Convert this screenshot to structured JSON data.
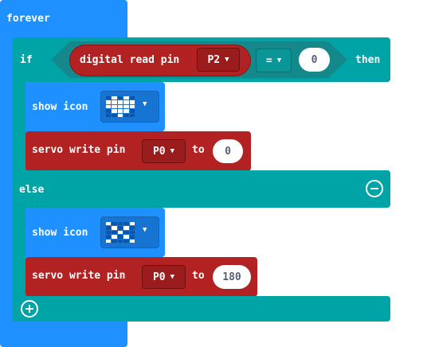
{
  "forever": {
    "label": "forever"
  },
  "if_block": {
    "if_label": "if",
    "then_label": "then",
    "else_label": "else",
    "condition": {
      "read_label": "digital read pin",
      "pin": "P2",
      "operator": "=",
      "value": "0"
    },
    "then_branch": {
      "show_icon_label": "show icon",
      "icon": "heart-icon",
      "icon_pattern": [
        0,
        1,
        0,
        1,
        0,
        1,
        1,
        1,
        1,
        1,
        1,
        1,
        1,
        1,
        1,
        0,
        1,
        1,
        1,
        0,
        0,
        0,
        1,
        0,
        0
      ],
      "servo_label": "servo write pin",
      "servo_pin": "P0",
      "to_label": "to",
      "servo_value": "0"
    },
    "else_branch": {
      "show_icon_label": "show icon",
      "icon": "x-icon",
      "icon_pattern": [
        1,
        0,
        0,
        0,
        1,
        0,
        1,
        0,
        1,
        0,
        0,
        0,
        1,
        0,
        0,
        0,
        1,
        0,
        1,
        0,
        1,
        0,
        0,
        0,
        1
      ],
      "servo_label": "servo write pin",
      "servo_pin": "P0",
      "to_label": "to",
      "servo_value": "180"
    }
  },
  "colors": {
    "basic_blue": "#1e90ff",
    "logic_teal": "#00a4a6",
    "pins_red": "#b22222"
  }
}
